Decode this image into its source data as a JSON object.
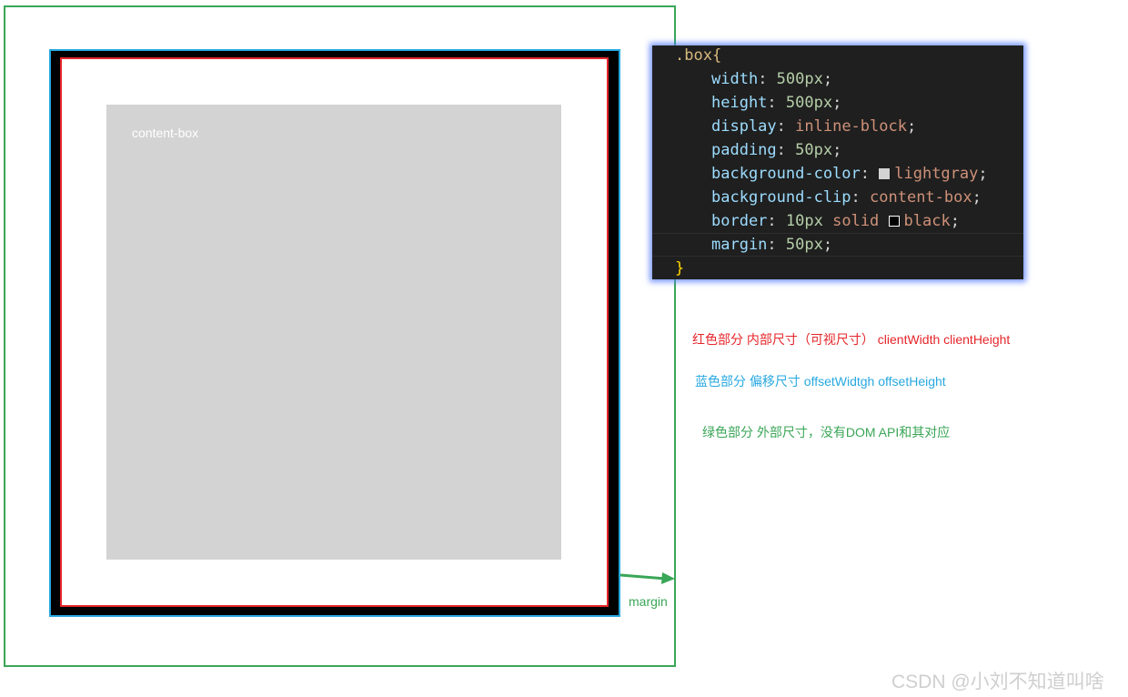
{
  "diagram": {
    "content_box_label": "content-box",
    "margin_label": "margin"
  },
  "code": {
    "selector_open": ".box{",
    "close_brace": "}",
    "lines": [
      {
        "prop": "width",
        "value": "500px"
      },
      {
        "prop": "height",
        "value": "500px"
      },
      {
        "prop": "display",
        "value": "inline-block"
      },
      {
        "prop": "padding",
        "value": "50px"
      },
      {
        "prop": "background-color",
        "value": "lightgray"
      },
      {
        "prop": "background-clip",
        "value": "content-box"
      },
      {
        "prop": "border",
        "value_num": "10px",
        "value_kw": "solid",
        "value_color": "black"
      },
      {
        "prop": "margin",
        "value": "50px"
      }
    ]
  },
  "legend": {
    "red": "红色部分  内部尺寸（可视尺寸）  clientWidth clientHeight",
    "blue": "蓝色部分  偏移尺寸  offsetWidtgh offsetHeight",
    "green": "绿色部分  外部尺寸，没有DOM API和其对应"
  },
  "watermark": "CSDN @小刘不知道叫啥",
  "colors": {
    "red": "#e5252a",
    "blue": "#27a8e0",
    "green": "#3aa657",
    "content": "#d3d3d3",
    "code_bg": "#1f1f1f"
  }
}
